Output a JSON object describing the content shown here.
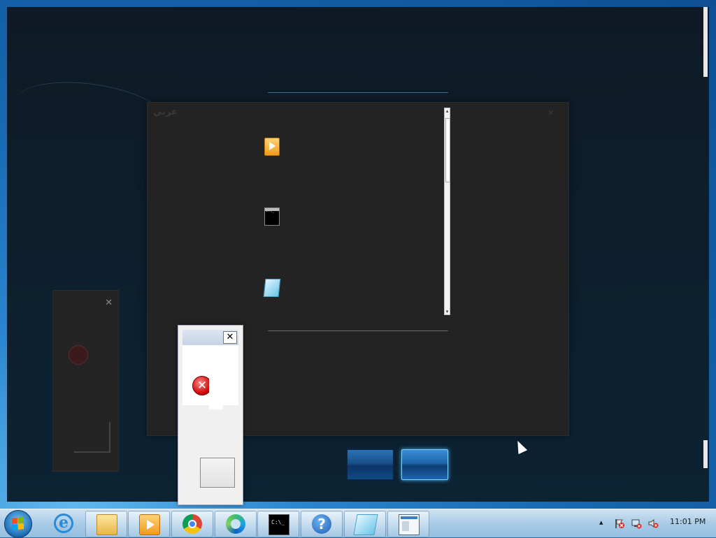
{
  "overlay": {
    "ghost_window_title": "عربي",
    "ghost_close": "✕"
  },
  "peek_list": {
    "items": [
      {
        "icon": "windows-media-player-icon"
      },
      {
        "icon": "command-prompt-icon"
      },
      {
        "icon": "notepad-icon"
      }
    ],
    "scroll_up": "▴",
    "scroll_down": "▾"
  },
  "small_ghost": {
    "close": "✕"
  },
  "error_dialog": {
    "close_label": "✕",
    "icon_glyph": "✕",
    "button_label": ""
  },
  "flip_buttons": [
    {
      "label": "",
      "selected": false
    },
    {
      "label": "",
      "selected": true
    }
  ],
  "taskbar": {
    "start": "start-orb-icon",
    "items": [
      {
        "icon": "internet-explorer-icon",
        "glyph": "e"
      },
      {
        "icon": "file-explorer-icon"
      },
      {
        "icon": "windows-media-player-icon"
      },
      {
        "icon": "chrome-icon"
      },
      {
        "icon": "edge-icon"
      },
      {
        "icon": "command-prompt-icon"
      },
      {
        "icon": "help-icon",
        "glyph": "?"
      },
      {
        "icon": "notepad-icon"
      },
      {
        "icon": "window-icon"
      }
    ],
    "tray": {
      "show_hidden": "▴",
      "clock": "11:01 PM"
    }
  }
}
